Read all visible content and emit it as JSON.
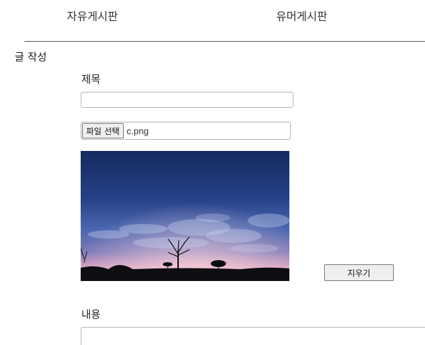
{
  "nav": {
    "tabs": [
      {
        "label": "자유게시판"
      },
      {
        "label": "유머게시판"
      }
    ]
  },
  "form": {
    "heading": "글 작성",
    "title_label": "제목",
    "title_value": "",
    "file_button_label": "파일 선택",
    "file_name": "c.png",
    "preview_image": "night-sky-landscape-photo",
    "clear_button_label": "지우기",
    "content_label": "내용",
    "content_value": ""
  }
}
